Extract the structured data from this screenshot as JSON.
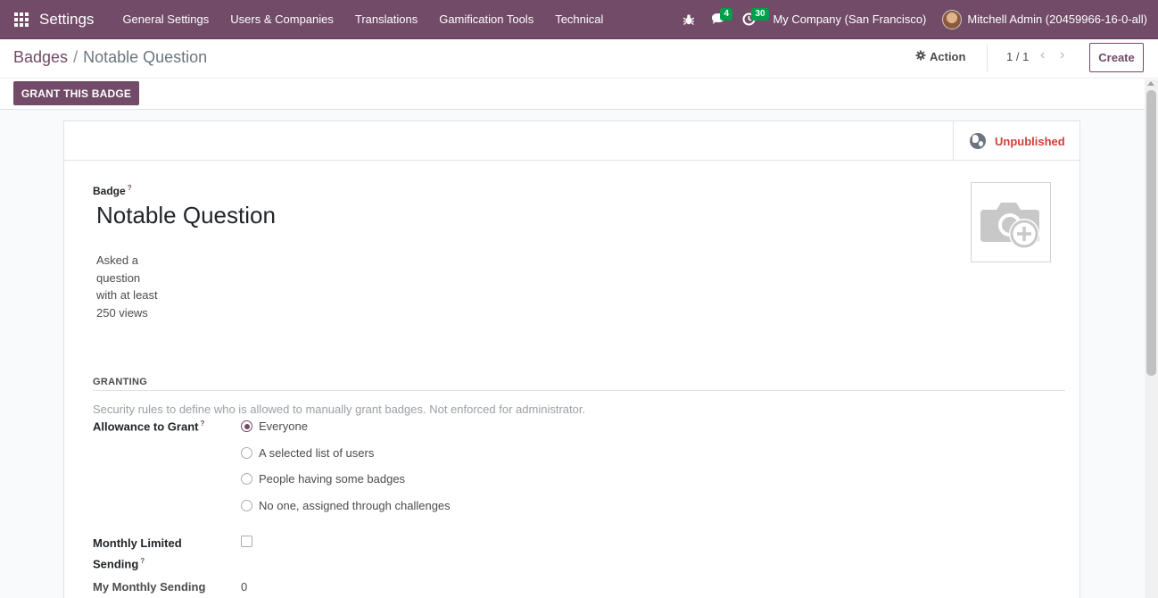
{
  "navbar": {
    "app_name": "Settings",
    "menu": [
      "General Settings",
      "Users & Companies",
      "Translations",
      "Gamification Tools",
      "Technical"
    ],
    "messages_count": "4",
    "activities_count": "30",
    "company": "My Company (San Francisco)",
    "user": "Mitchell Admin (20459966-16-0-all)"
  },
  "breadcrumb": {
    "parent": "Badges",
    "separator": "/",
    "current": "Notable Question"
  },
  "control": {
    "action_label": "Action",
    "pager": "1 / 1",
    "create_label": "Create",
    "grant_label": "GRANT THIS BADGE"
  },
  "form": {
    "publish_status": "Unpublished",
    "badge_label": "Badge",
    "help_mark": "?",
    "badge_name": "Notable Question",
    "description": "Asked a question with at least 250 views",
    "granting": {
      "title": "GRANTING",
      "help": "Security rules to define who is allowed to manually grant badges. Not enforced for administrator.",
      "allowance_label": "Allowance to Grant",
      "options": [
        "Everyone",
        "A selected list of users",
        "People having some badges",
        "No one, assigned through challenges"
      ],
      "selected": "Everyone"
    },
    "monthly_limited_label": "Monthly Limited Sending",
    "monthly_limited_checked": false,
    "my_monthly_label": "My Monthly Sending",
    "my_monthly_value": "0"
  },
  "colors": {
    "brand": "#714b67",
    "unpublished": "#d23f3a",
    "badge_green": "#00a04a"
  }
}
